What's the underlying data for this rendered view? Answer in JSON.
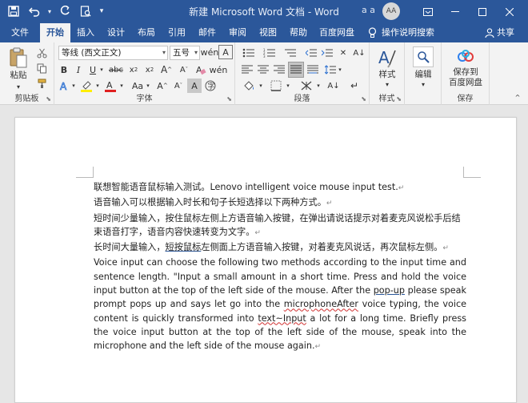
{
  "window": {
    "title": "新建 Microsoft Word 文档  -  Word",
    "user_initials_small": "a a",
    "avatar_initials": "AA"
  },
  "tabs": [
    {
      "label": "文件"
    },
    {
      "label": "开始"
    },
    {
      "label": "插入"
    },
    {
      "label": "设计"
    },
    {
      "label": "布局"
    },
    {
      "label": "引用"
    },
    {
      "label": "邮件"
    },
    {
      "label": "审阅"
    },
    {
      "label": "视图"
    },
    {
      "label": "帮助"
    },
    {
      "label": "百度网盘"
    }
  ],
  "tell_me": "操作说明搜索",
  "share": "共享",
  "ribbon": {
    "clipboard": {
      "label": "剪贴板",
      "paste": "粘贴"
    },
    "font": {
      "label": "字体",
      "font_name": "等线 (西文正文)",
      "font_size": "五号"
    },
    "paragraph": {
      "label": "段落"
    },
    "styles": {
      "label": "样式",
      "button": "样式"
    },
    "editing": {
      "button": "编辑"
    },
    "save": {
      "label": "保存",
      "button_line1": "保存到",
      "button_line2": "百度网盘"
    }
  },
  "document": {
    "p1": "联想智能语音鼠标输入测试。Lenovo intelligent voice mouse input test.",
    "p2": "语音输入可以根据输入时长和句子长短选择以下两种方式。",
    "p3": "短时间少量输入，按住鼠标左侧上方语音输入按键，在弹出请说话提示对着麦克风说松手后结束语音打字，语音内容快速转变为文字。",
    "p4_a": "长时间大量输入，",
    "p4_b": "短按鼠标",
    "p4_c": "左侧面上方语音输入按键，对着麦克风说话，再次鼠标左侧。",
    "p5_a": "Voice input can choose the following two methods according to the input time and sentence length. \"Input a small amount in a short time. Press and hold the voice input button at the top of the left side of the mouse. After the ",
    "p5_b": "pop-up",
    "p5_c": " please speak prompt pops up and says let go into the ",
    "p5_d": "microphoneAfter",
    "p5_e": " voice typing, the voice content is quickly transformed into ",
    "p5_f": "text~Input",
    "p5_g": " a lot for a long time. Briefly press the voice input button at the top of the left side of the mouse, speak into the microphone and the left side of the mouse again.",
    "para_mark": "↵"
  },
  "colors": {
    "accent": "#2b579a",
    "ribbon_bg": "#f3f3f3"
  }
}
